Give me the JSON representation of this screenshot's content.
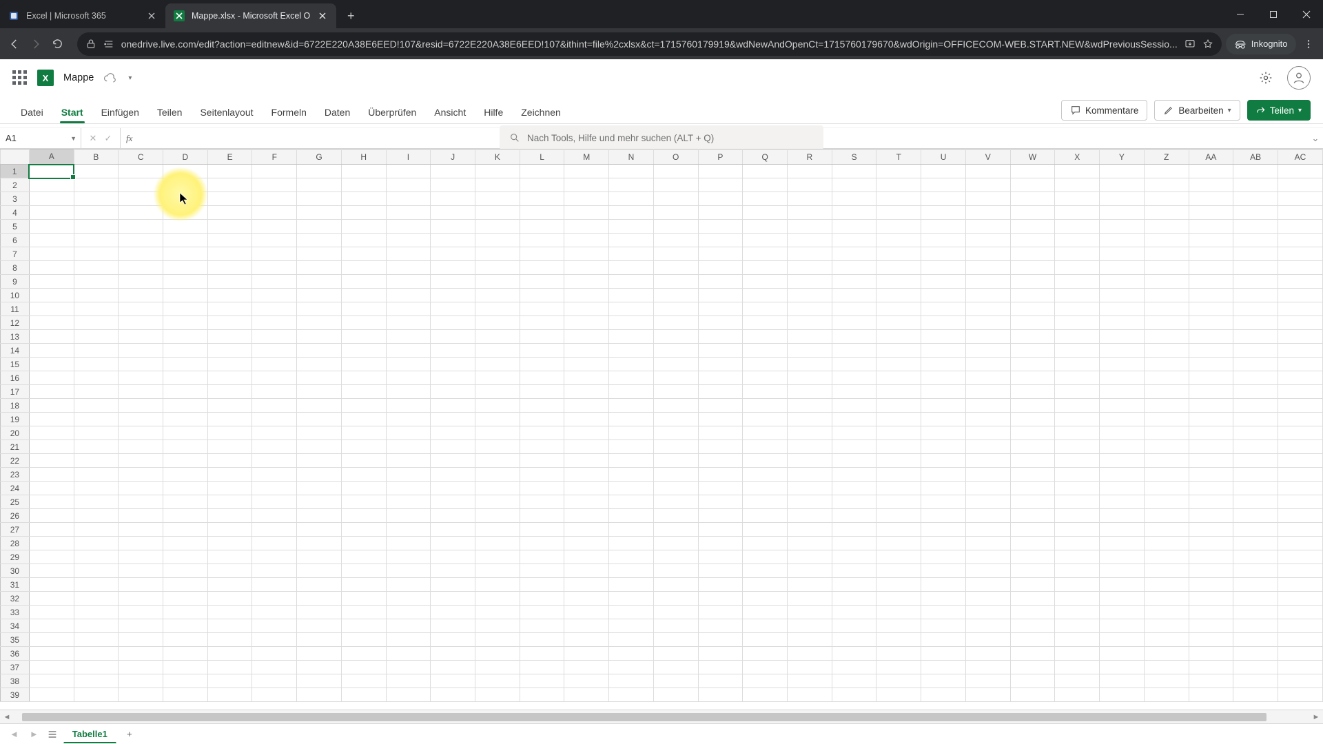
{
  "browser": {
    "tabs": [
      {
        "title": "Excel | Microsoft 365",
        "active": false
      },
      {
        "title": "Mappe.xlsx - Microsoft Excel O",
        "active": true
      }
    ],
    "url": "onedrive.live.com/edit?action=editnew&id=6722E220A38E6EED!107&resid=6722E220A38E6EED!107&ithint=file%2cxlsx&ct=1715760179919&wdNewAndOpenCt=1715760179670&wdOrigin=OFFICECOM-WEB.START.NEW&wdPreviousSessio...",
    "incognito_label": "Inkognito"
  },
  "app": {
    "doc_title": "Mappe",
    "search_placeholder": "Nach Tools, Hilfe und mehr suchen (ALT + Q)"
  },
  "ribbon": {
    "tabs": [
      "Datei",
      "Start",
      "Einfügen",
      "Teilen",
      "Seitenlayout",
      "Formeln",
      "Daten",
      "Überprüfen",
      "Ansicht",
      "Hilfe",
      "Zeichnen"
    ],
    "active_tab": "Start",
    "comments_label": "Kommentare",
    "edit_label": "Bearbeiten",
    "share_label": "Teilen"
  },
  "formula_bar": {
    "name_box": "A1",
    "formula": ""
  },
  "grid": {
    "columns": [
      "A",
      "B",
      "C",
      "D",
      "E",
      "F",
      "G",
      "H",
      "I",
      "J",
      "K",
      "L",
      "M",
      "N",
      "O",
      "P",
      "Q",
      "R",
      "S",
      "T",
      "U",
      "V",
      "W",
      "X",
      "Y",
      "Z",
      "AA",
      "AB",
      "AC"
    ],
    "row_count": 39,
    "selected_cell": "A1",
    "selected_col": "A",
    "selected_row": 1
  },
  "sheets": {
    "active": "Tabelle1"
  }
}
